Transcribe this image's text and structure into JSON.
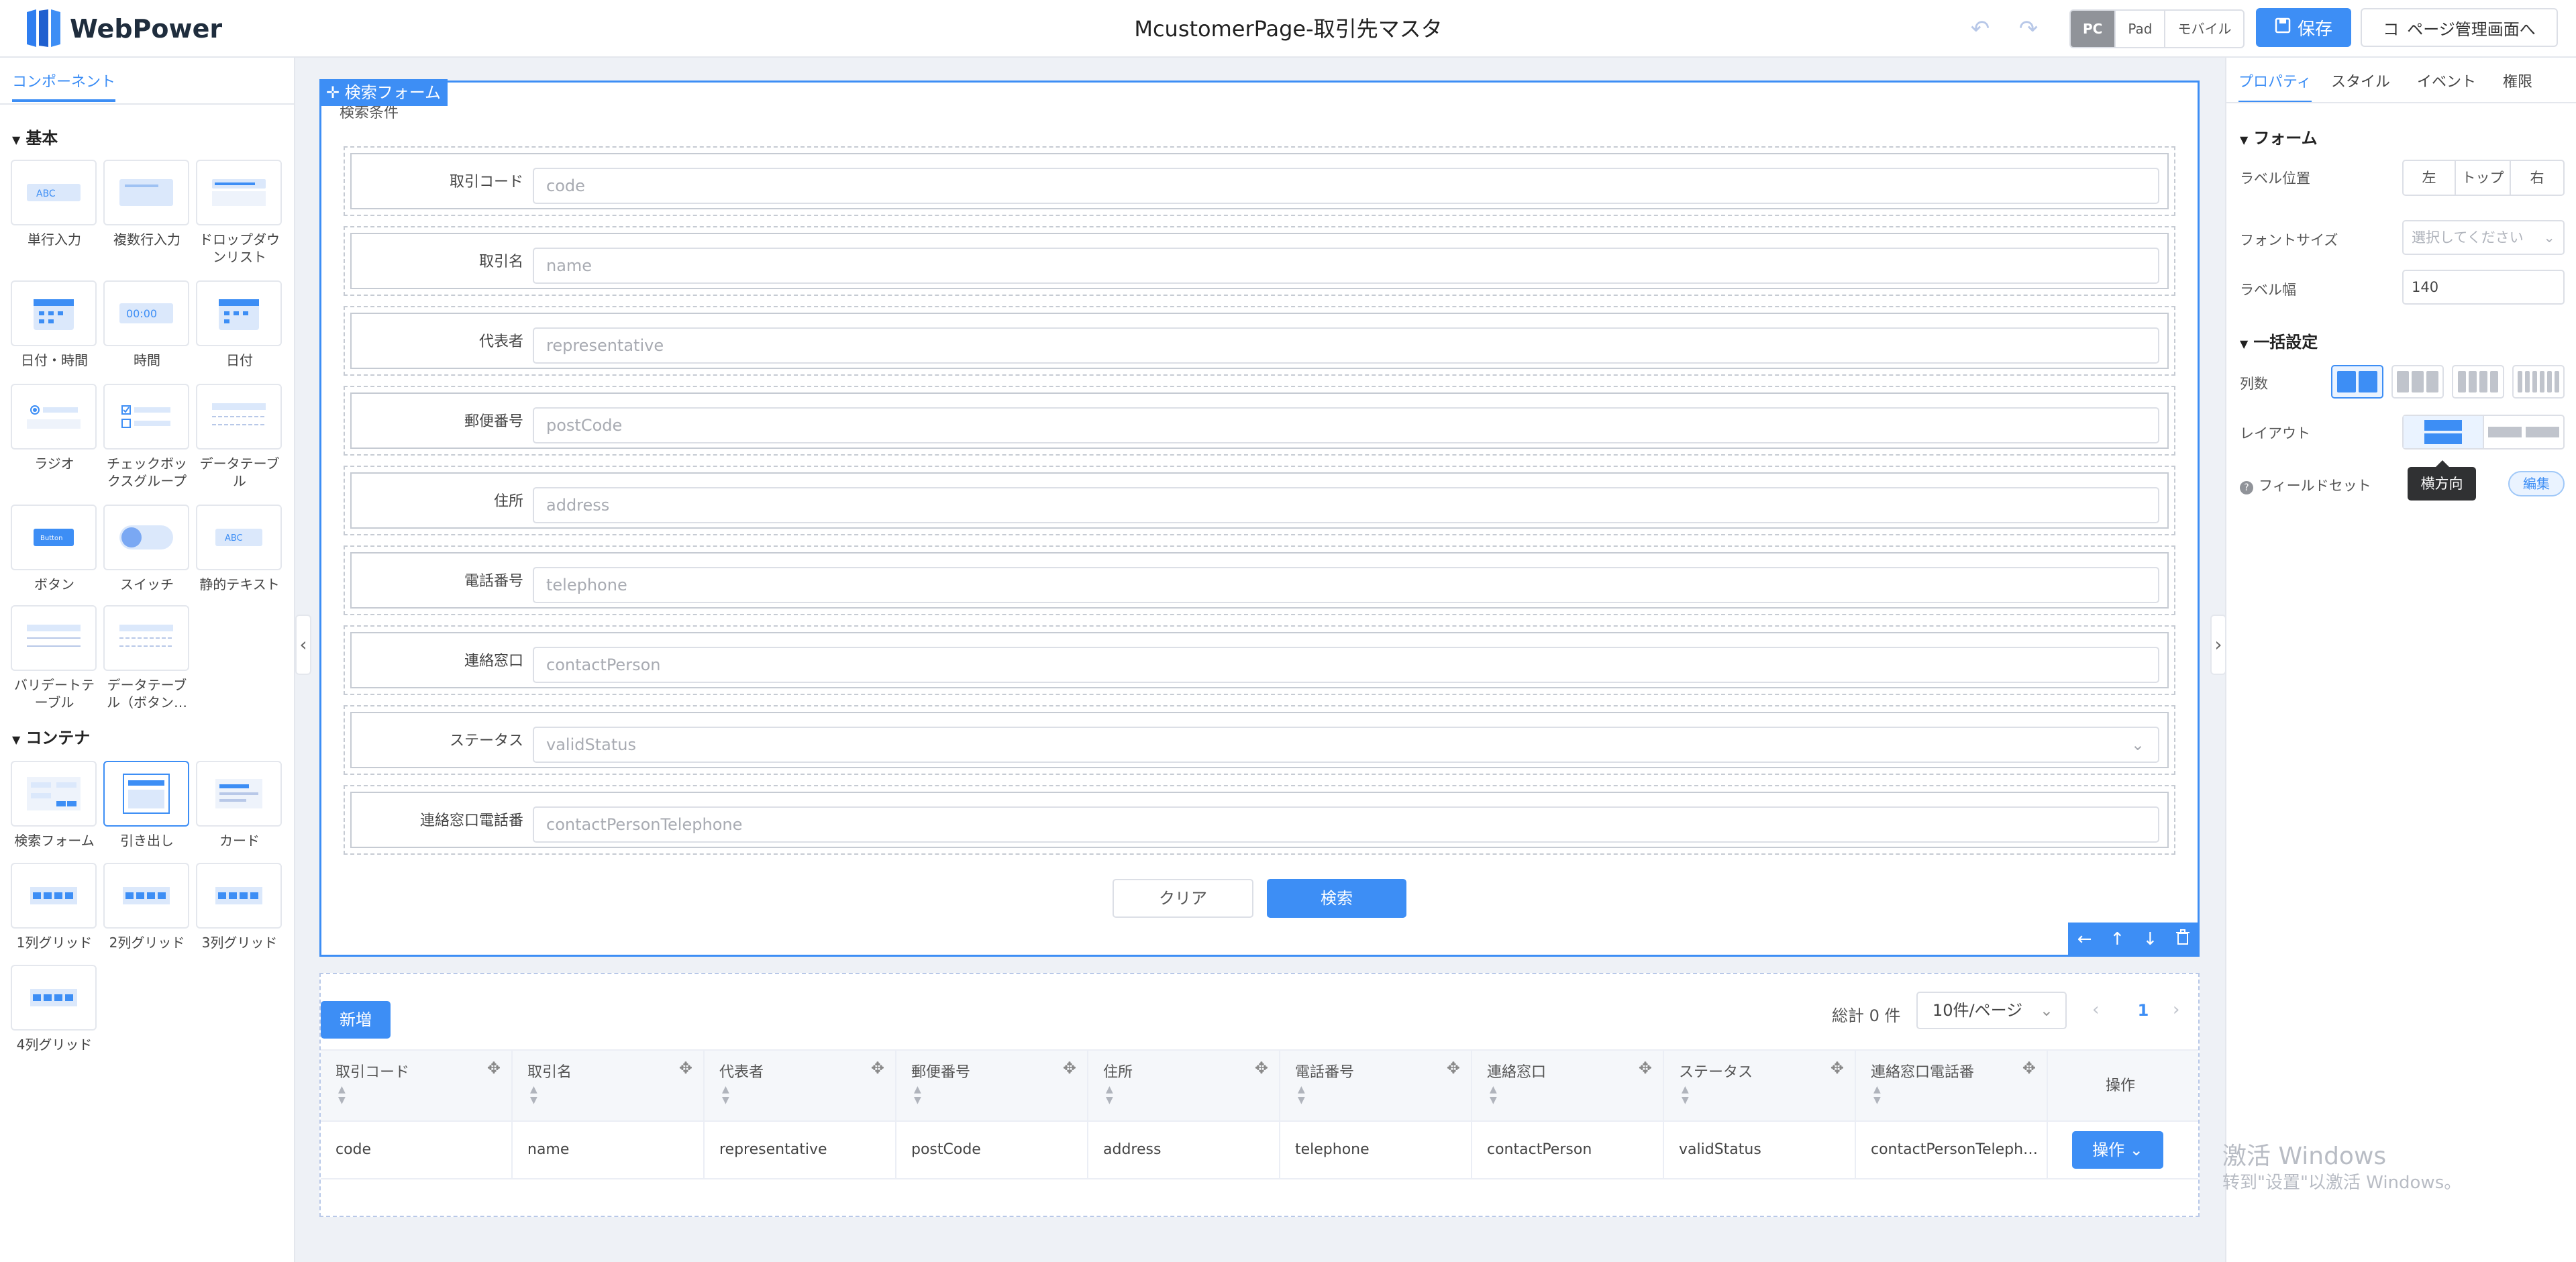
{
  "header": {
    "brand": "WebPower",
    "page_title": "McustomerPage-取引先マスタ",
    "undo_glyph": "↶",
    "redo_glyph": "↷",
    "devices": [
      "PC",
      "Pad",
      "モバイル"
    ],
    "active_device": "PC",
    "save_label": "保存",
    "page_mgmt_prefix": "コ",
    "page_mgmt_label": "ページ管理画面へ"
  },
  "left_panel": {
    "tab": "コンポーネント",
    "basic_title": "基本",
    "basic_items": [
      "単行入力",
      "複数行入力",
      "ドロップダウンリスト",
      "日付・時間",
      "時間",
      "日付",
      "ラジオ",
      "チェックボックスグループ",
      "データテーブル",
      "ボタン",
      "スイッチ",
      "静的テキスト",
      "バリデートテーブル",
      "データテーブル（ボタン…"
    ],
    "container_title": "コンテナ",
    "container_items": [
      "検索フォーム",
      "引き出し",
      "カード",
      "1列グリッド",
      "2列グリッド",
      "3列グリッド",
      "4列グリッド"
    ],
    "thumb_texts": {
      "single": "ABC",
      "time": "00:00",
      "static": "ABC",
      "button": "Button"
    }
  },
  "form": {
    "tag": "検索フォーム",
    "subtitle": "検索条件",
    "fields": [
      {
        "label": "取引コード",
        "placeholder": "code"
      },
      {
        "label": "取引名",
        "placeholder": "name"
      },
      {
        "label": "代表者",
        "placeholder": "representative"
      },
      {
        "label": "郵便番号",
        "placeholder": "postCode"
      },
      {
        "label": "住所",
        "placeholder": "address"
      },
      {
        "label": "電話番号",
        "placeholder": "telephone"
      },
      {
        "label": "連絡窓口",
        "placeholder": "contactPerson"
      },
      {
        "label": "ステータス",
        "placeholder": "validStatus"
      },
      {
        "label": "連絡窓口電話番",
        "placeholder": "contactPersonTelephone"
      }
    ],
    "clear_label": "クリア",
    "search_label": "検索"
  },
  "table": {
    "new_label": "新増",
    "total_label": "総計 0 件",
    "page_size": "10件/ページ",
    "current_page": "1",
    "headers": [
      "取引コード",
      "取引名",
      "代表者",
      "郵便番号",
      "住所",
      "電話番号",
      "連絡窓口",
      "ステータス",
      "連絡窓口電話番",
      "操作"
    ],
    "row": [
      "code",
      "name",
      "representative",
      "postCode",
      "address",
      "telephone",
      "contactPerson",
      "validStatus",
      "contactPersonTeleph…"
    ],
    "op_label": "操作"
  },
  "right_panel": {
    "tabs": [
      "プロパティ",
      "スタイル",
      "イベント",
      "権限"
    ],
    "active_tab": "プロパティ",
    "form_title": "フォーム",
    "label_position": "ラベル位置",
    "label_position_options": [
      "左",
      "トップ",
      "右"
    ],
    "font_size": "フォントサイズ",
    "font_size_placeholder": "選択してください",
    "label_width": "ラベル幅",
    "label_width_value": "140",
    "bulk_title": "一括設定",
    "columns": "列数",
    "layout": "レイアウト",
    "fieldset": "フィールドセット",
    "tooltip": "横方向",
    "edit_label": "編集"
  },
  "watermark": {
    "line1": "激活 Windows",
    "line2": "转到\"设置\"以激活 Windows。"
  },
  "colors": {
    "accent": "#3d8ef5",
    "canvas": "#eef1f6"
  }
}
